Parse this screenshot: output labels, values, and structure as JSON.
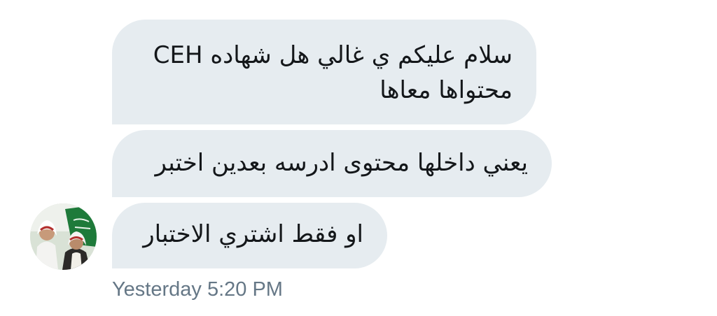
{
  "conversation": {
    "messages": [
      {
        "lines": [
          "سلام عليكم ي غالي هل شهاده CEH",
          "محتواها معاها"
        ]
      },
      {
        "lines": [
          "يعني داخلها محتوى ادرسه بعدين اختبر"
        ]
      },
      {
        "lines": [
          "او فقط اشتري الاختبار"
        ]
      }
    ],
    "timestamp": "Yesterday 5:20 PM"
  },
  "sender": {
    "avatar_icon": "profile-photo",
    "flag_color": "#1e7a3a"
  }
}
